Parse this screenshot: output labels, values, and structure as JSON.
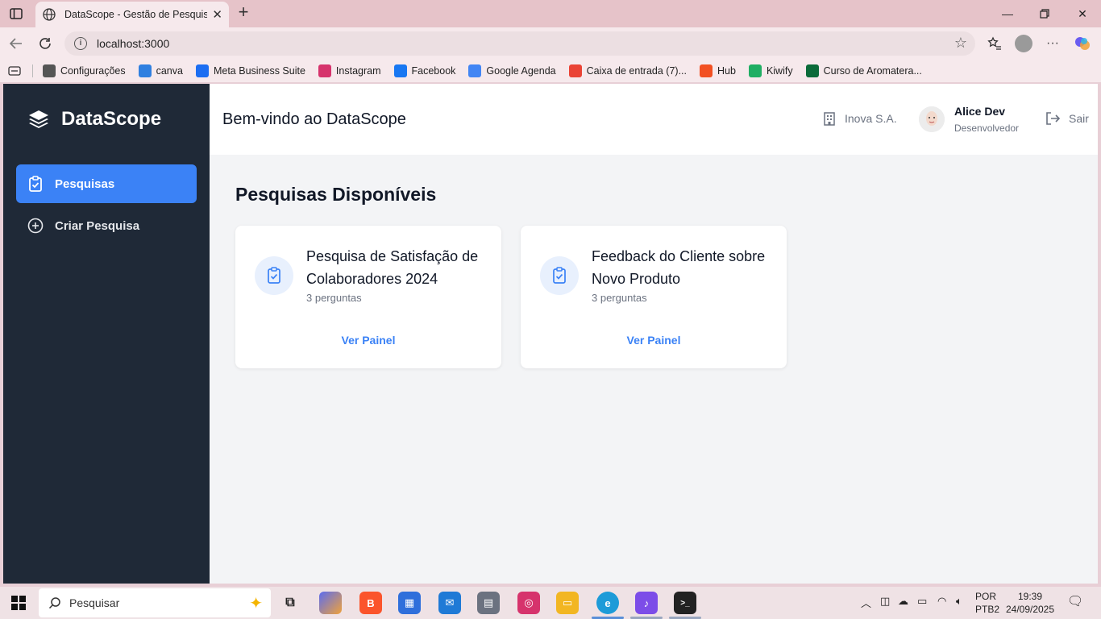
{
  "browser": {
    "tab_title": "DataScope - Gestão de Pesquisas",
    "url": "localhost:3000",
    "bookmarks": [
      {
        "label": "Configurações",
        "icon": "gear-icon",
        "color": "#555555"
      },
      {
        "label": "canva",
        "icon": "canva-icon",
        "color": "#2f7fe0"
      },
      {
        "label": "Meta Business Suite",
        "icon": "meta-icon",
        "color": "#1c6ef2"
      },
      {
        "label": "Instagram",
        "icon": "instagram-icon",
        "color": "#d6336c"
      },
      {
        "label": "Facebook",
        "icon": "facebook-icon",
        "color": "#1877f2"
      },
      {
        "label": "Google Agenda",
        "icon": "calendar-icon",
        "color": "#4285f4"
      },
      {
        "label": "Caixa de entrada (7)...",
        "icon": "gmail-icon",
        "color": "#ea4335"
      },
      {
        "label": "Hub",
        "icon": "hub-icon",
        "color": "#f25022"
      },
      {
        "label": "Kiwify",
        "icon": "kiwify-icon",
        "color": "#1fae63"
      },
      {
        "label": "Curso de Aromatera...",
        "icon": "course-icon",
        "color": "#0b6b3a"
      }
    ]
  },
  "app": {
    "brand": "DataScope",
    "nav": [
      {
        "label": "Pesquisas",
        "active": true
      },
      {
        "label": "Criar Pesquisa",
        "active": false
      }
    ],
    "header": {
      "welcome": "Bem-vindo ao DataScope",
      "company": "Inova S.A.",
      "user_name": "Alice Dev",
      "user_role": "Desenvolvedor",
      "logout": "Sair"
    },
    "section_title": "Pesquisas Disponíveis",
    "surveys": [
      {
        "title": "Pesquisa de Satisfação de Colaboradores 2024",
        "count": "3 perguntas",
        "action": "Ver Painel"
      },
      {
        "title": "Feedback do Cliente sobre Novo Produto",
        "count": "3 perguntas",
        "action": "Ver Painel"
      }
    ],
    "colors": {
      "sidebar": "#1f2937",
      "accent": "#3b82f6"
    }
  },
  "taskbar": {
    "search_placeholder": "Pesquisar",
    "lang_line1": "POR",
    "lang_line2": "PTB2",
    "time": "19:39",
    "date": "24/09/2025"
  }
}
